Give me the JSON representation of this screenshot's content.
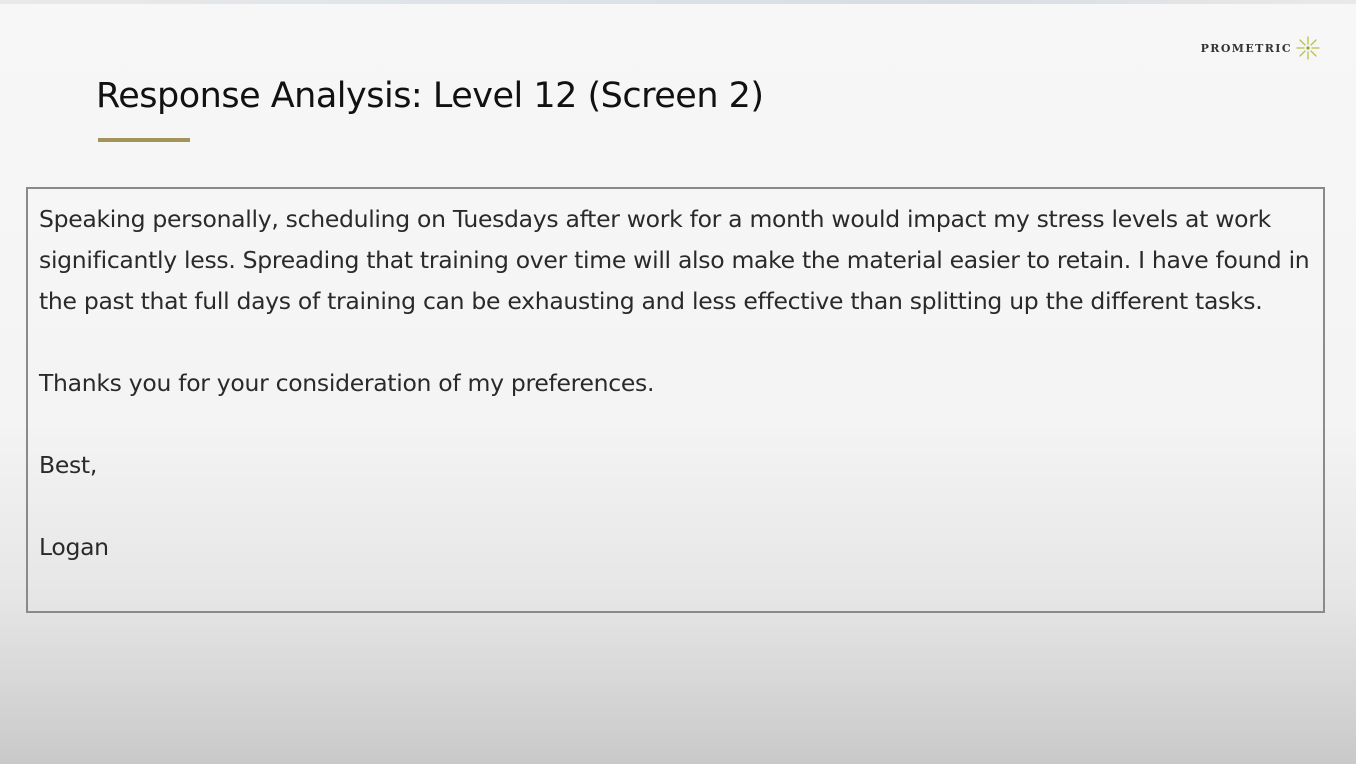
{
  "brand": {
    "logo_text": "PROMETRIC",
    "logo_icon": "starburst-icon",
    "accent_color": "#a3945a"
  },
  "slide": {
    "title": "Response Analysis: Level 12 (Screen 2)"
  },
  "response": {
    "paragraph_1": "Speaking personally, scheduling on Tuesdays after work for a month would impact my stress levels at work significantly less. Spreading that training over time will also make the material easier to retain. I have found in the past that full days of training can be exhausting and less effective than splitting up the different tasks.",
    "paragraph_2": "Thanks you for your consideration of my preferences.",
    "closing": "Best,",
    "signature": "Logan"
  }
}
